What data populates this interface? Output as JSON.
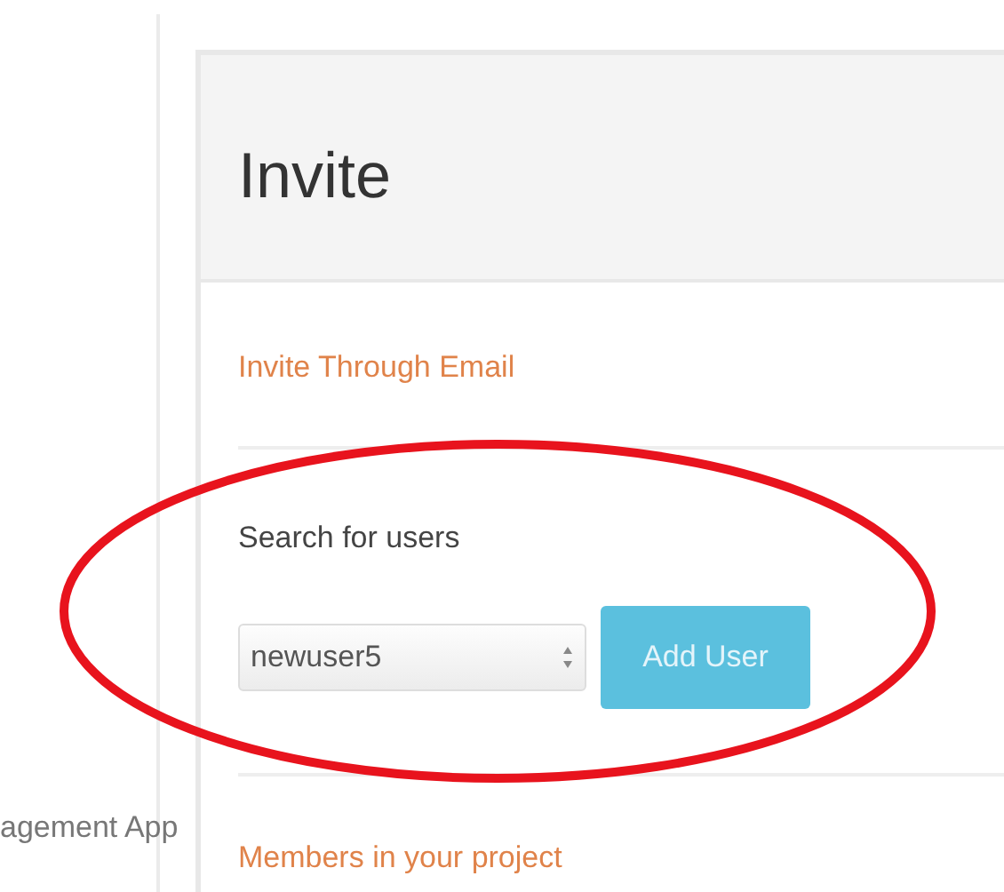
{
  "sidebar": {
    "app_name": "agement App"
  },
  "panel": {
    "title": "Invite",
    "invite_link": "Invite Through Email",
    "search_label": "Search for users",
    "user_select": {
      "value": "newuser5"
    },
    "add_button": "Add User",
    "members_link": "Members in your project"
  },
  "annotation": {
    "kind": "ellipse",
    "color": "#e8131d"
  }
}
